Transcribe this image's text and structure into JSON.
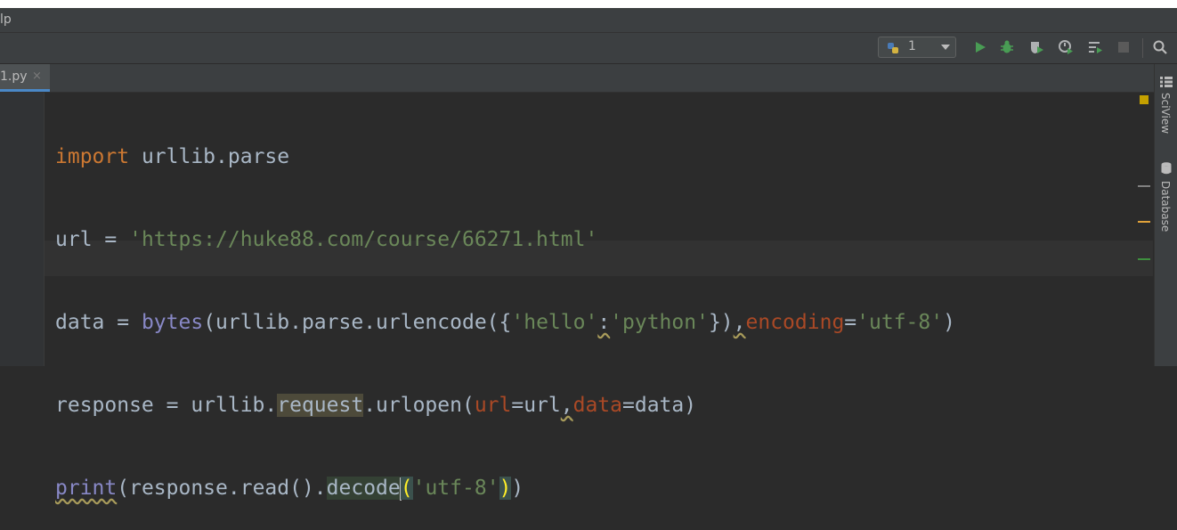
{
  "menubar": {
    "text": "lp"
  },
  "toolbar": {
    "run_config_label": "1",
    "icons": [
      "python-icon",
      "run-icon",
      "debug-icon",
      "coverage-icon",
      "profile-icon",
      "concurrency-icon",
      "stop-icon",
      "search-icon"
    ],
    "colors": {
      "run": "#499c54",
      "stop": "#5a5a5a"
    }
  },
  "tabs": [
    {
      "label": "1.py",
      "close": "×"
    }
  ],
  "code": {
    "l1": {
      "kw": "import",
      "rest": " urllib.parse"
    },
    "l2": {
      "a": "url = ",
      "s": "'https://huke88.com/course/66271.html'"
    },
    "l3": {
      "a": "data = ",
      "fn": "bytes",
      "b": "(urllib.parse.urlencode({",
      "s1": "'hello'",
      "colon": ":",
      "s2": "'python'",
      "c": "})",
      "comma": ",",
      "p": "encoding",
      "eq": "=",
      "s3": "'utf-8'",
      "close": ")"
    },
    "l4": {
      "a": "response = urllib.",
      "hl": "request",
      "b": ".urlopen(",
      "p1": "url",
      "c": "=url",
      "comma": ",",
      "p2": "data",
      "d": "=data)"
    },
    "l5": {
      "fn": "print",
      "a": "(response.read().",
      "dec": "decode",
      "lp": "(",
      "s": "'utf-8'",
      "rp": ")",
      "end": ")"
    }
  },
  "right_panel": {
    "sciview": "SciView",
    "database": "Database"
  }
}
